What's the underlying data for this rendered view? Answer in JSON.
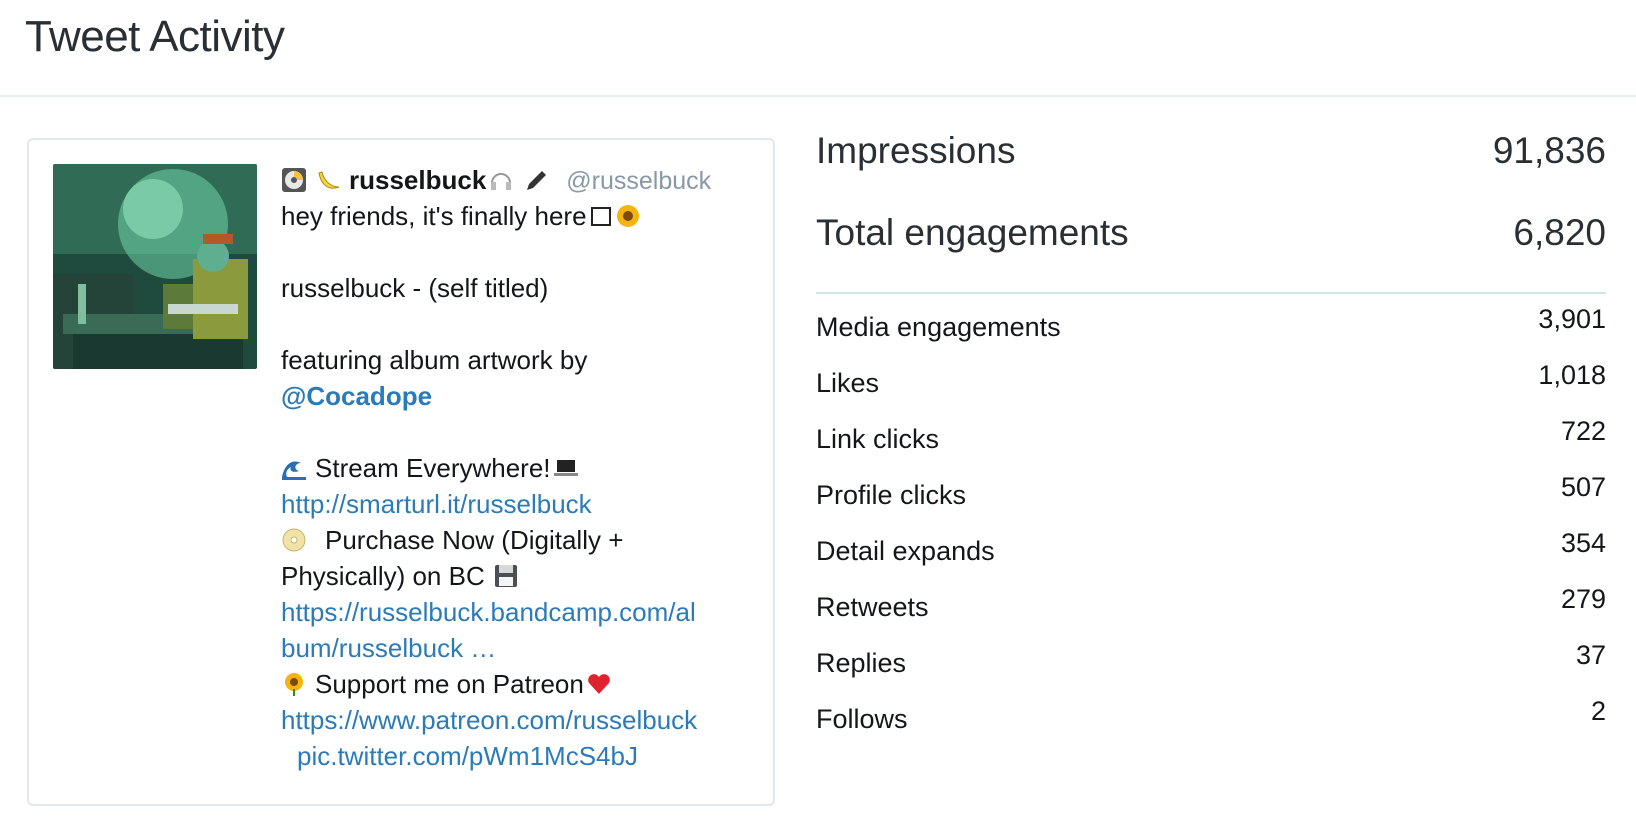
{
  "page": {
    "title": "Tweet Activity"
  },
  "tweet": {
    "display_name": "russelbuck",
    "handle": "@russelbuck",
    "lines": {
      "l1": "hey friends, it's finally here",
      "l2": "russelbuck - (self titled)",
      "l3": "featuring album artwork by",
      "mention": "@Cocadope",
      "l4": "Stream Everywhere!",
      "link1": "http://smarturl.it/russelbuck",
      "l5a": "Purchase Now (Digitally +",
      "l5b": "Physically) on BC",
      "link2a": "https://russelbuck.bandcamp.com/al",
      "link2b": "bum/russelbuck …",
      "l6": "Support me on Patreon",
      "link3": "https://www.patreon.com/russelbuck",
      "pic": "pic.twitter.com/pWm1McS4bJ"
    },
    "icons": [
      "cd-icon",
      "banana-icon",
      "headphones-icon",
      "pen-icon",
      "box-icon",
      "sunflower-icon",
      "wave-icon",
      "laptop-icon",
      "dvd-icon",
      "floppy-icon",
      "heart-icon"
    ]
  },
  "stats": {
    "impressions": {
      "label": "Impressions",
      "value": "91,836"
    },
    "engagements": {
      "label": "Total engagements",
      "value": "6,820"
    },
    "rows": [
      {
        "label": "Media engagements",
        "value": "3,901"
      },
      {
        "label": "Likes",
        "value": "1,018"
      },
      {
        "label": "Link clicks",
        "value": "722"
      },
      {
        "label": "Profile clicks",
        "value": "507"
      },
      {
        "label": "Detail expands",
        "value": "354"
      },
      {
        "label": "Retweets",
        "value": "279"
      },
      {
        "label": "Replies",
        "value": "37"
      },
      {
        "label": "Follows",
        "value": "2"
      }
    ]
  }
}
